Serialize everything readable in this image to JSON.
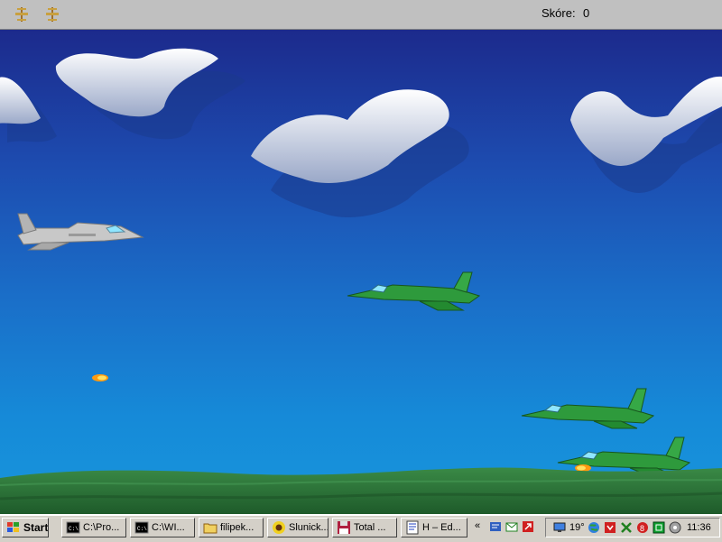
{
  "hud": {
    "score_label": "Skóre:",
    "score_value": "0",
    "lives": [
      "player-plane-life-icon",
      "player-plane-life-icon"
    ]
  },
  "game": {
    "sky_colors": {
      "top": "#1c2a8c",
      "bottom": "#1896dc"
    },
    "ground_color": "#2f7a3a",
    "player_plane_color": "#c8c8c8",
    "enemy_plane_color": "#2e9a3c",
    "missile_color": "#ff9a10"
  },
  "taskbar": {
    "start_label": "Start",
    "tasks": [
      {
        "label": "C:\\Pro...",
        "icon": "console-icon"
      },
      {
        "label": "C:\\WI...",
        "icon": "console-icon"
      },
      {
        "label": "filipek...",
        "icon": "folder-icon"
      },
      {
        "label": "Slunick...",
        "icon": "sunflower-icon"
      },
      {
        "label": "Total ...",
        "icon": "floppy-disk-icon"
      },
      {
        "label": "H – Ed...",
        "icon": "editor-icon"
      }
    ],
    "quick_launch": [
      "chevron-icon",
      "network-icon",
      "mail-icon",
      "arrow-icon"
    ],
    "tray": {
      "temperature": "19°",
      "clock": "11:36",
      "icons": [
        "monitor-icon",
        "globe-icon",
        "shield-icon",
        "tools-icon",
        "antivirus-icon",
        "box-icon",
        "cd-icon"
      ]
    }
  }
}
